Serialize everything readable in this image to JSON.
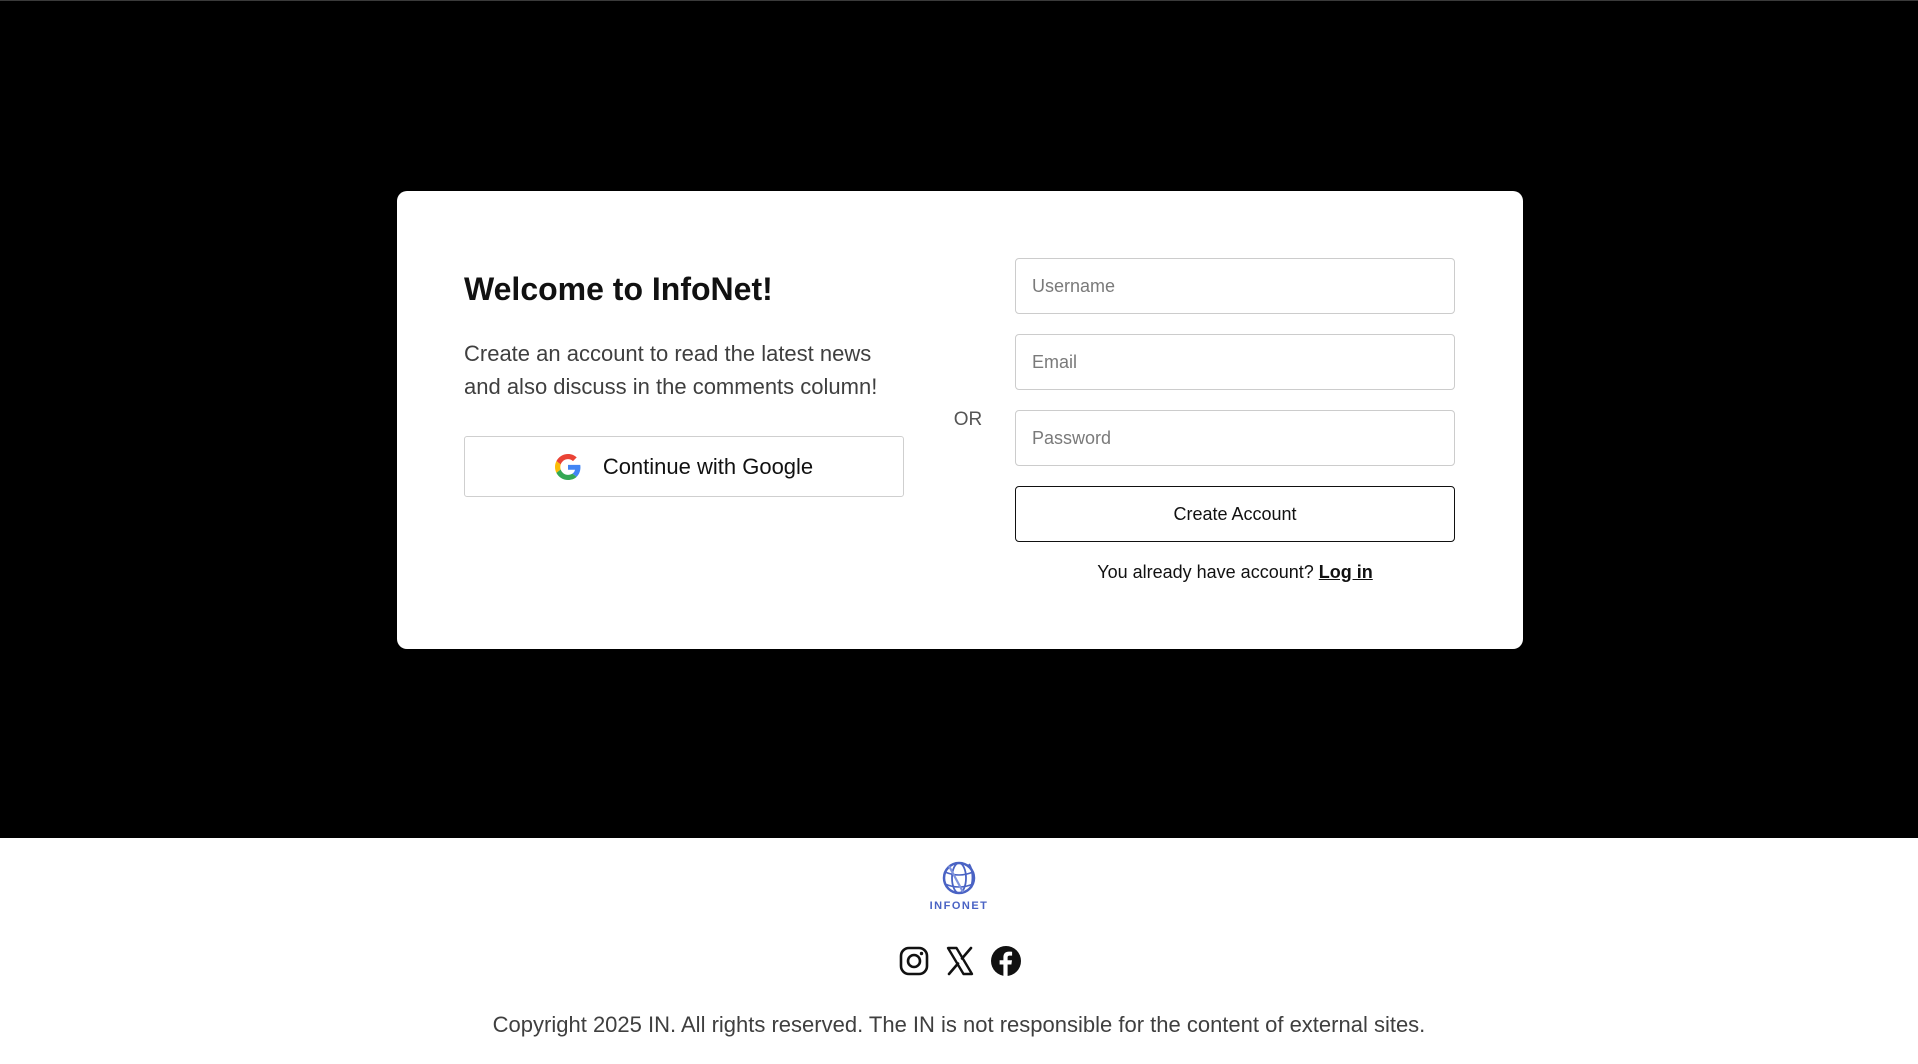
{
  "card": {
    "title": "Welcome to InfoNet!",
    "subtitle": "Create an account to read the latest news and also discuss in the comments column!",
    "google_label": "Continue with Google",
    "separator": "OR"
  },
  "form": {
    "username_placeholder": "Username",
    "username_value": "",
    "email_placeholder": "Email",
    "email_value": "",
    "password_placeholder": "Password",
    "password_value": "",
    "submit_label": "Create Account",
    "login_prompt": "You already have account?",
    "login_link": "Log in"
  },
  "footer": {
    "logo_text": "INFONET",
    "social_icons": [
      "instagram-icon",
      "x-icon",
      "facebook-icon"
    ],
    "copyright": "Copyright 2025 IN. All rights reserved. The IN is not responsible for the content of external sites."
  },
  "colors": {
    "background_dark": "#000000",
    "card": "#ffffff",
    "logo_blue": "#4a63c4",
    "text": "#111111"
  }
}
